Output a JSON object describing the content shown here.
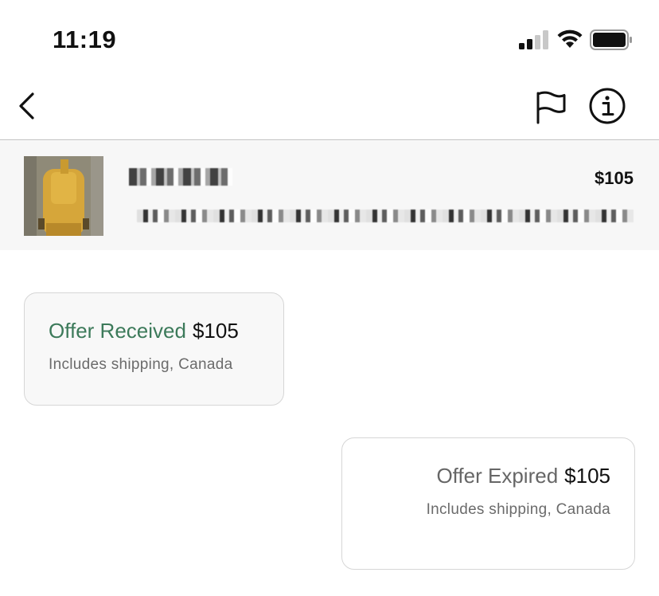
{
  "status_bar": {
    "time": "11:19",
    "icons": [
      "cellular-signal-icon",
      "wifi-icon",
      "battery-icon"
    ]
  },
  "nav_bar": {
    "icons": [
      "back-chevron-icon",
      "flag-icon",
      "info-icon"
    ]
  },
  "listing": {
    "price": "$105",
    "thumbnail_color": "#d6a63a"
  },
  "messages": [
    {
      "status": "Offer Received",
      "amount": "$105",
      "note": "Includes shipping, Canada",
      "status_color": "#3c7a5a"
    },
    {
      "status": "Offer Expired",
      "amount": "$105",
      "note": "Includes shipping, Canada",
      "status_color": "#666666"
    }
  ]
}
